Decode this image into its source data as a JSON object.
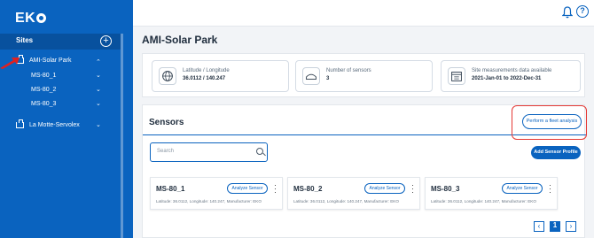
{
  "app": {
    "logo": "EK"
  },
  "sidebar": {
    "sites_label": "Sites",
    "add_label": "+",
    "sites": [
      {
        "name": "AMI-Solar Park",
        "chevron": "⌃",
        "sensors": [
          "MS-80_1",
          "MS-80_2",
          "MS-80_3"
        ]
      },
      {
        "name": "La Motte-Servolex",
        "chevron": "⌄"
      }
    ],
    "sub_chevron": "⌄"
  },
  "header": {
    "bell_icon": "bell-icon",
    "help_label": "?"
  },
  "page": {
    "title": "AMI-Solar Park"
  },
  "info": [
    {
      "label": "Latitude / Longitude",
      "value": "36.0112 / 140.247",
      "icon": "globe-icon"
    },
    {
      "label": "Number of sensors",
      "value": "3",
      "icon": "sensor-icon"
    },
    {
      "label": "Site measurements data available",
      "value": "2021-Jan-01 to 2022-Dec-31",
      "icon": "calendar-icon"
    }
  ],
  "sensors": {
    "title": "Sensors",
    "fleet_button": "Perform a fleet analysis",
    "search_placeholder": "Search",
    "add_button": "Add Sensor Profile",
    "analyze_label": "Analyze Sensor",
    "cards": [
      {
        "name": "MS-80_1",
        "meta": "Latitude: 36.0112, Longitude: 140.247, Manufacturer: EKO"
      },
      {
        "name": "MS-80_2",
        "meta": "Latitude: 36.0112, Longitude: 140.247, Manufacturer: EKO"
      },
      {
        "name": "MS-80_3",
        "meta": "Latitude: 36.0112, Longitude: 140.247, Manufacturer: EKO"
      }
    ]
  },
  "pagination": {
    "prev": "‹",
    "current": "1",
    "next": "›"
  },
  "colors": {
    "brand": "#0a63bf",
    "highlight": "#e53935"
  }
}
